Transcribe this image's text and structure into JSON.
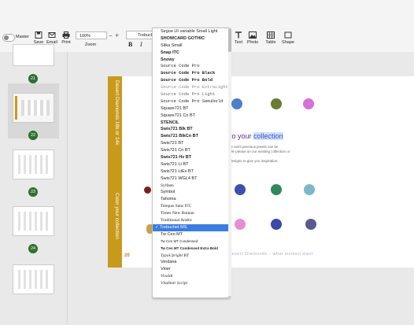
{
  "toolbar": {
    "mode_label": "Master",
    "buttons": [
      {
        "label": "Save",
        "icon": "save-icon"
      },
      {
        "label": "Email",
        "icon": "email-icon"
      },
      {
        "label": "Print",
        "icon": "print-icon"
      }
    ],
    "zoom_value": "100%",
    "zoom_label": "Zoom",
    "font_value": "Trebuchet",
    "bold_label": "B",
    "italic_label": "I",
    "right_buttons": [
      {
        "label": "Text",
        "icon": "text-icon"
      },
      {
        "label": "Photo",
        "icon": "photo-icon"
      },
      {
        "label": "Table",
        "icon": "table-icon"
      },
      {
        "label": "Shape",
        "icon": "shape-icon"
      }
    ]
  },
  "sidebar": {
    "page_numbers": [
      "21",
      "22",
      "23",
      "24"
    ]
  },
  "page": {
    "banner_top": "Desert Diamonds 18k or 14k",
    "banner_bottom": "Color your collection",
    "heading_prefix": "to your ",
    "heading_highlight": "collection",
    "para1": "ur semi precious jewels can be",
    "para2": "ple please on our existing collection or",
    "para3": "designs to give you inspiration.",
    "footer": "Desert Diamonds · what women want",
    "page_number": "20"
  },
  "font_menu": {
    "items": [
      "Segoe UI variable Small Light",
      "SHOWCARD GOTHIC",
      "Sitka Small",
      "Snap ITC",
      "Snowy",
      "Source Code Pro",
      "Source Code Pro Black",
      "Source Code Pro Bold",
      "Source Code Pro ExtraLight",
      "Source Code Pro Light",
      "Source Code Pro Semibold",
      "Square721 BT",
      "Square721 Cn BT",
      "STENCIL",
      "Swis721 Blk BT",
      "Swis721 BlkCn BT",
      "Swis721 BT",
      "Swis721 Cn BT",
      "Swis721 Hv BT",
      "Swis721 Lt BT",
      "Swis721 LtEx BT",
      "Swis721 WGL4 BT",
      "Sylfaen",
      "Symbol",
      "Tahoma",
      "Tempus Sans ITC",
      "Times New Roman",
      "Traditional Arabic",
      "Trebuchet MS",
      "Tw Cen MT",
      "Tw Cen MT Condensed",
      "Tw Cen MT Condensed Extra Bold",
      "TypoUpright BT",
      "Verdana",
      "Viner",
      "Vivaldi",
      "Vladimir Script"
    ],
    "selected": "Trebuchet MS",
    "check_mark": "✓"
  },
  "colors": {
    "banner": "#c89a1c",
    "heading": "#5d2b88",
    "selection": "#3b7de0",
    "page_badge": "#2f6f2f"
  }
}
